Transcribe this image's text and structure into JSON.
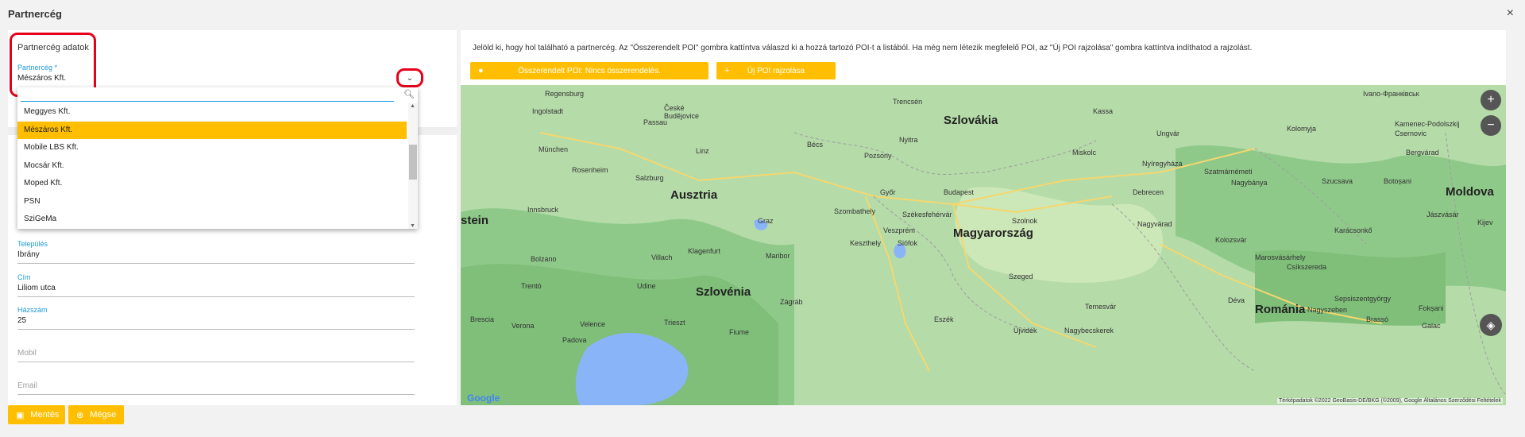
{
  "dialog": {
    "title": "Partnercég",
    "close_icon": "×"
  },
  "form": {
    "section_title": "Partnercég adatok",
    "partner": {
      "label": "Partnercég *",
      "value": "Mészáros Kft."
    },
    "dropdown": {
      "items": [
        "Meggyes Kft.",
        "Mészáros Kft.",
        "Mobile LBS Kft.",
        "Mocsár Kft.",
        "Moped Kft.",
        "PSN",
        "SziGeMa"
      ],
      "selected_index": 1
    },
    "fields": [
      {
        "label": "Település",
        "value": "Ibrány"
      },
      {
        "label": "Cím",
        "value": "Liliom utca"
      },
      {
        "label": "Házszám",
        "value": "25"
      },
      {
        "label": "",
        "value": "Mobil"
      },
      {
        "label": "",
        "value": "Email"
      }
    ]
  },
  "info": {
    "text": "Jelöld ki, hogy hol található a partnercég. Az \"Összerendelt POI\" gombra kattíntva válaszd ki a hozzá tartozó POI-t a listából. Ha még nem létezik megfelelő POI, az \"Új POI rajzolása\" gombra kattíntva indíthatod a rajzolást."
  },
  "buttons": {
    "assigned_poi": "Összerendelt POI: Nincs összerendelés.",
    "new_poi": "Új POI rajzolása",
    "save": "Mentés",
    "cancel": "Mégse"
  },
  "map": {
    "countries": [
      {
        "name": "Szlovákia"
      },
      {
        "name": "Ausztria"
      },
      {
        "name": "Magyarország"
      },
      {
        "name": "Szlovénia"
      },
      {
        "name": "Románia"
      },
      {
        "name": "Moldova"
      },
      {
        "name": "stein"
      }
    ],
    "cities": [
      {
        "name": "Regensburg"
      },
      {
        "name": "České Budějovice"
      },
      {
        "name": "Trencsén"
      },
      {
        "name": "Ivano-Франківськ"
      },
      {
        "name": "Ingolstadt"
      },
      {
        "name": "Passau"
      },
      {
        "name": "Kassa"
      },
      {
        "name": "Bécs"
      },
      {
        "name": "Pozsony"
      },
      {
        "name": "München"
      },
      {
        "name": "Nyitra"
      },
      {
        "name": "Miskolc"
      },
      {
        "name": "Nyíregyháza"
      },
      {
        "name": "Linz"
      },
      {
        "name": "Salzburg"
      },
      {
        "name": "Rosenheim"
      },
      {
        "name": "Győr"
      },
      {
        "name": "Budapest"
      },
      {
        "name": "Debrecen"
      },
      {
        "name": "Innsbruck"
      },
      {
        "name": "Szombathely"
      },
      {
        "name": "Székesfehérvár"
      },
      {
        "name": "Szolnok"
      },
      {
        "name": "Graz"
      },
      {
        "name": "Veszprém"
      },
      {
        "name": "Nagyvárad"
      },
      {
        "name": "Kolozsvár"
      },
      {
        "name": "Klagenfurt"
      },
      {
        "name": "Maribor"
      },
      {
        "name": "Keszthely"
      },
      {
        "name": "Siófok"
      },
      {
        "name": "Bolzano"
      },
      {
        "name": "Villach"
      },
      {
        "name": "Szeged"
      },
      {
        "name": "Marosvásárhely"
      },
      {
        "name": "Zágráb"
      },
      {
        "name": "Temesvár"
      },
      {
        "name": "Déva"
      },
      {
        "name": "Nagyszeben"
      },
      {
        "name": "Brassó"
      },
      {
        "name": "Trentó"
      },
      {
        "name": "Udine"
      },
      {
        "name": "Velence"
      },
      {
        "name": "Trieszt"
      },
      {
        "name": "Verona"
      },
      {
        "name": "Brescia"
      },
      {
        "name": "Padova"
      },
      {
        "name": "Fiume"
      },
      {
        "name": "Eszék"
      },
      {
        "name": "Újvidék"
      },
      {
        "name": "Nagybecskerek"
      },
      {
        "name": "Galac"
      },
      {
        "name": "Jászvásár"
      },
      {
        "name": "Kijev"
      },
      {
        "name": "Botoșani"
      },
      {
        "name": "Szucsava"
      },
      {
        "name": "Csernovic"
      },
      {
        "name": "Kamenec-Podolszkij"
      },
      {
        "name": "Szatmárnémeti"
      },
      {
        "name": "Nagybánya"
      },
      {
        "name": "Ungvár"
      },
      {
        "name": "Kolomyja"
      },
      {
        "name": "Karácsonkő"
      },
      {
        "name": "Sepsiszentgyörgy"
      },
      {
        "name": "Fokșani"
      },
      {
        "name": "Csíkszereda"
      },
      {
        "name": "Bergvárad"
      }
    ],
    "attribution": "Térképadatok ©2022 GeoBasis-DE/BKG (©2009), Google   Általános Szerződési Feltételek",
    "google_logo": "Google"
  },
  "colors": {
    "accent": "#ffbf00",
    "label_blue": "#1a9ae0",
    "highlight_red": "#e8001a"
  }
}
